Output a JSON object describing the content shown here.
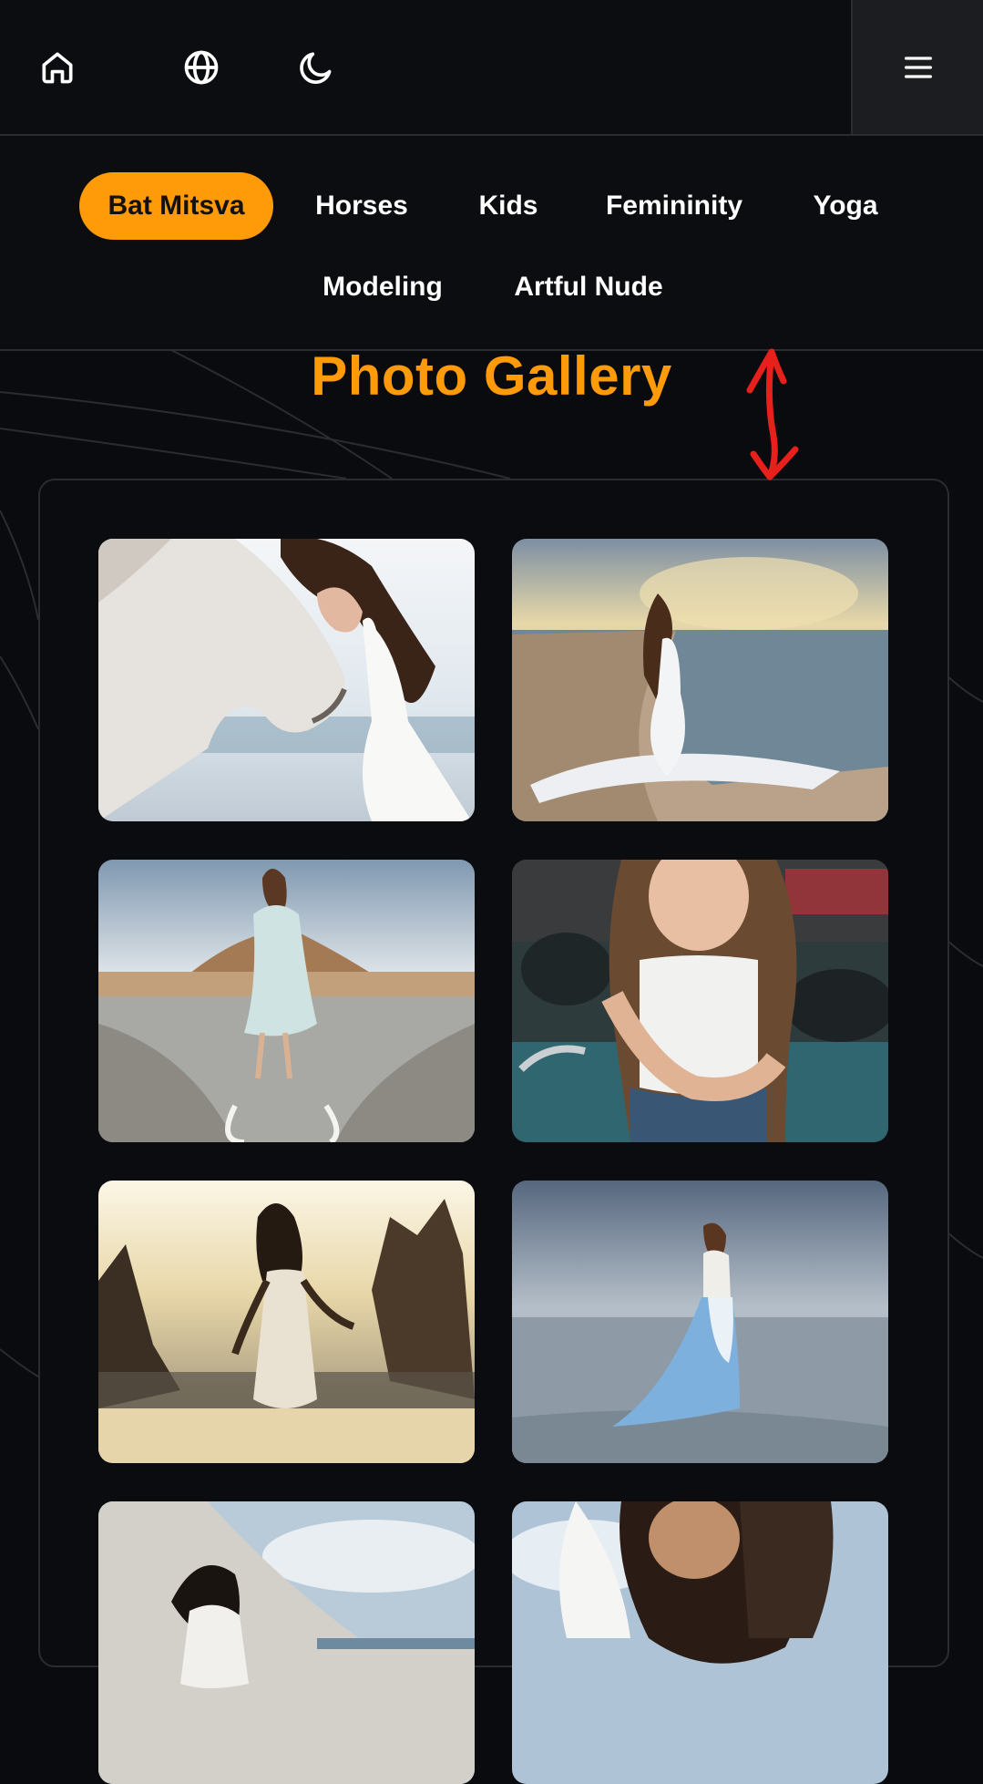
{
  "header": {
    "icons": [
      "home-icon",
      "globe-icon",
      "moon-icon",
      "menu-icon"
    ]
  },
  "categories": [
    {
      "label": "Bat Mitsva",
      "active": true
    },
    {
      "label": "Horses",
      "active": false
    },
    {
      "label": "Kids",
      "active": false
    },
    {
      "label": "Femininity",
      "active": false
    },
    {
      "label": "Yoga",
      "active": false
    },
    {
      "label": "Modeling",
      "active": false
    },
    {
      "label": "Artful Nude",
      "active": false
    }
  ],
  "gallery": {
    "title": "Photo Gallery",
    "photos": [
      {
        "subject": "girl with white horse by the sea"
      },
      {
        "subject": "girl in white dress sitting on beach"
      },
      {
        "subject": "girl in light dress walking in shallow water"
      },
      {
        "subject": "girl in white top at harbor"
      },
      {
        "subject": "silhouette of girl between sea rocks at sunset"
      },
      {
        "subject": "girl in blue gradient dress standing in sea"
      },
      {
        "subject": "girl on sand dunes"
      },
      {
        "subject": "girl with dark horse"
      }
    ]
  },
  "colors": {
    "accent": "#ff9a08",
    "background": "#0a0b0e",
    "annotation": "#e8201c"
  }
}
